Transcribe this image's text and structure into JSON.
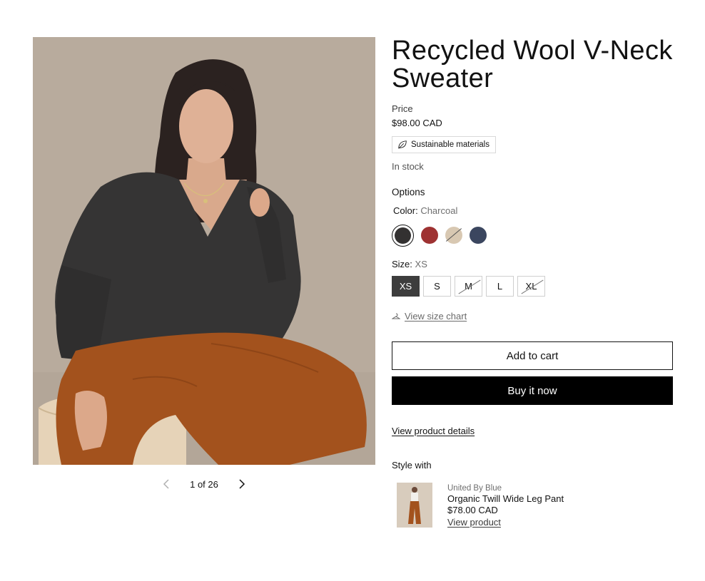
{
  "gallery": {
    "image_alt": "product-photo",
    "counter": "1 of 26"
  },
  "product": {
    "title": "Recycled Wool V-Neck Sweater",
    "price_label": "Price",
    "price": "$98.00 CAD",
    "badge": "Sustainable materials",
    "stock": "In stock"
  },
  "options": {
    "label": "Options",
    "color_label": "Color:",
    "color_value": "Charcoal",
    "colors": [
      {
        "name": "Charcoal",
        "hex": "#333131",
        "selected": true,
        "available": true
      },
      {
        "name": "Red",
        "hex": "#9e3232",
        "selected": false,
        "available": true
      },
      {
        "name": "Oatmeal",
        "hex": "#d8c8b2",
        "selected": false,
        "available": false
      },
      {
        "name": "Navy",
        "hex": "#3b465f",
        "selected": false,
        "available": true
      }
    ],
    "size_label": "Size:",
    "size_value": "XS",
    "sizes": [
      {
        "label": "XS",
        "selected": true,
        "available": true
      },
      {
        "label": "S",
        "selected": false,
        "available": true
      },
      {
        "label": "M",
        "selected": false,
        "available": false
      },
      {
        "label": "L",
        "selected": false,
        "available": true
      },
      {
        "label": "XL",
        "selected": false,
        "available": false
      }
    ]
  },
  "actions": {
    "size_chart": "View size chart",
    "add_to_cart": "Add to cart",
    "buy_now": "Buy it now",
    "product_details": "View product details"
  },
  "style_with": {
    "heading": "Style with",
    "item": {
      "vendor": "United By Blue",
      "name": "Organic Twill Wide Leg Pant",
      "price": "$78.00 CAD",
      "link": "View product"
    }
  },
  "colors": {
    "text": "#121212",
    "muted": "#6f6f6f",
    "selected_size_bg": "#3d3d3d",
    "buy_button_bg": "#000000"
  }
}
